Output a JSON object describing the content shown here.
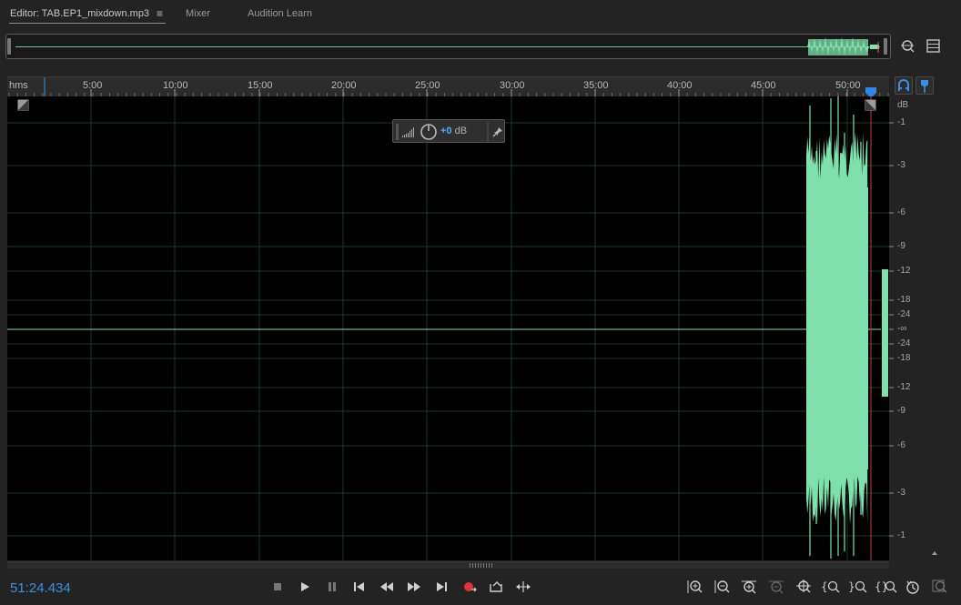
{
  "tabs": {
    "editor_label": "Editor: TAB.EP1_mixdown.mp3",
    "menu_glyph": "≡",
    "mixer_label": "Mixer",
    "learn_label": "Audition Learn"
  },
  "ruler": {
    "unit_label": "hms",
    "ticks": [
      "5:00",
      "10:00",
      "15:00",
      "20:00",
      "25:00",
      "30:00",
      "35:00",
      "40:00",
      "45:00",
      "50:00"
    ]
  },
  "db_scale": {
    "unit_label": "dB",
    "labels": [
      "-1",
      "-3",
      "-6",
      "-9",
      "-12",
      "-18",
      "-24",
      "-∞",
      "-24",
      "-18",
      "-12",
      "-9",
      "-6",
      "-3",
      "-1"
    ]
  },
  "hud": {
    "value": "+0",
    "unit": " dB"
  },
  "transport": {
    "timecode": "51:24.434"
  },
  "colors": {
    "waveform": "#7fe0ad",
    "accent": "#3d8fe0",
    "record": "#e0323a"
  },
  "icons": [
    "zoom-to-time-icon",
    "view-list-icon",
    "snap-icon",
    "marker-icon",
    "stop-icon",
    "play-icon",
    "pause-icon",
    "go-to-start-icon",
    "rewind-icon",
    "fast-forward-icon",
    "go-to-end-icon",
    "record-icon",
    "loop-icon",
    "skip-selection-icon",
    "zoom-in-amplitude-icon",
    "zoom-out-amplitude-icon",
    "zoom-in-time-icon",
    "zoom-out-time-icon",
    "zoom-out-full-icon",
    "zoom-in-point-icon",
    "zoom-in-left-icon",
    "zoom-in-right-icon",
    "zoom-selection-icon",
    "history-icon",
    "zoom-reset-icon"
  ]
}
